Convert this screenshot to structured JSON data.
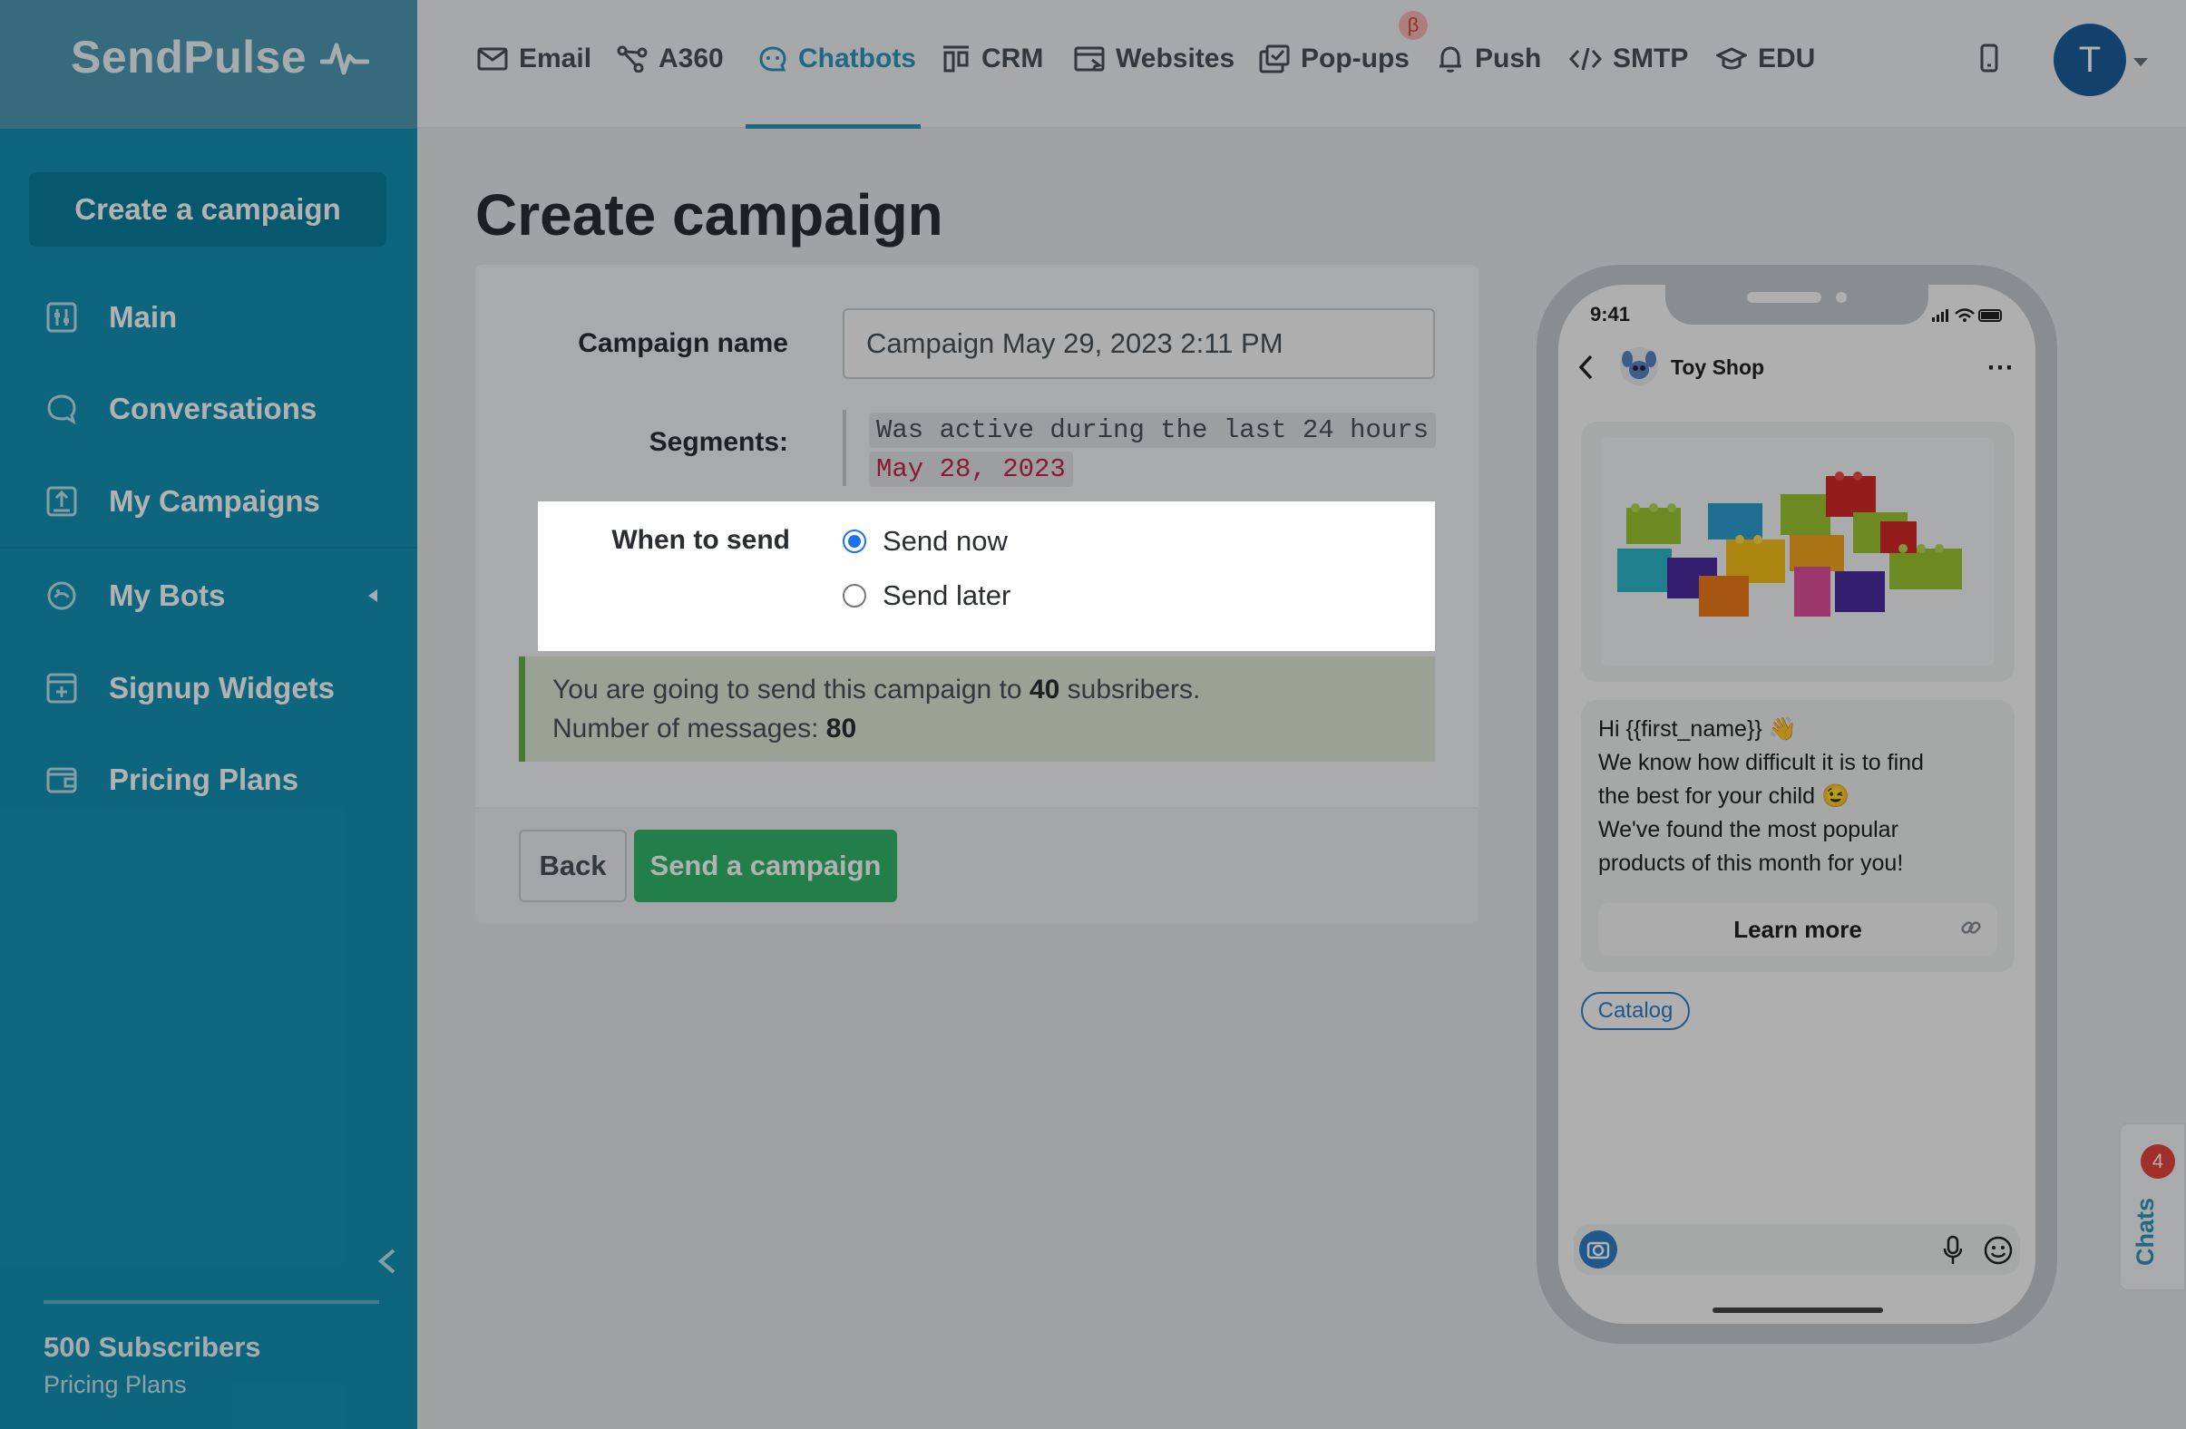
{
  "brand": {
    "logo_text": "SendPulse"
  },
  "sidebar": {
    "create_label": "Create a campaign",
    "items": [
      {
        "label": "Main",
        "icon": "dashboard-icon"
      },
      {
        "label": "Conversations",
        "icon": "chat-bubble-icon"
      },
      {
        "label": "My Campaigns",
        "icon": "upload-icon"
      },
      {
        "label": "My Bots",
        "icon": "bot-icon"
      },
      {
        "label": "Signup Widgets",
        "icon": "widget-icon"
      },
      {
        "label": "Pricing Plans",
        "icon": "wallet-icon"
      }
    ],
    "subscribers": "500 Subscribers",
    "plan_link": "Pricing Plans"
  },
  "topnav": {
    "items": [
      {
        "label": "Email",
        "icon": "envelope-icon"
      },
      {
        "label": "A360",
        "icon": "nodes-icon"
      },
      {
        "label": "Chatbots",
        "icon": "chatbot-icon",
        "active": true
      },
      {
        "label": "CRM",
        "icon": "crm-icon"
      },
      {
        "label": "Websites",
        "icon": "browser-icon"
      },
      {
        "label": "Pop-ups",
        "icon": "popup-icon"
      },
      {
        "label": "Push",
        "icon": "bell-icon"
      },
      {
        "label": "SMTP",
        "icon": "code-icon"
      },
      {
        "label": "EDU",
        "icon": "graduation-cap-icon"
      }
    ],
    "beta_badge": "β",
    "avatar_initial": "T",
    "accent": "#2d97ba"
  },
  "page": {
    "title": "Create campaign",
    "campaign_name_label": "Campaign name",
    "campaign_name_value": "Campaign May 29, 2023 2:11 PM",
    "segments_label": "Segments:",
    "segments": [
      "Was active during the last 24 hours",
      "May 28, 2023"
    ],
    "when_label": "When to send",
    "send_now": "Send now",
    "send_later": "Send later",
    "selected_option": "Send now",
    "info_prefix": "You are going to send this campaign to",
    "info_count": "40",
    "info_suffix": "subsribers.",
    "messages_prefix": "Number of messages:",
    "messages_count": "80",
    "back_label": "Back",
    "send_label": "Send a campaign",
    "send_color": "#33b669"
  },
  "phone": {
    "time": "9:41",
    "shop_name": "Toy Shop",
    "message_lines": [
      "Hi {{first_name}} 👋",
      "We know how difficult it is to find",
      "the best for your child 😉",
      "We've found the most popular",
      "products of this month for you!"
    ],
    "learn_more": "Learn more",
    "quick_reply": "Catalog"
  },
  "chats": {
    "label": "Chats",
    "badge": "4"
  }
}
